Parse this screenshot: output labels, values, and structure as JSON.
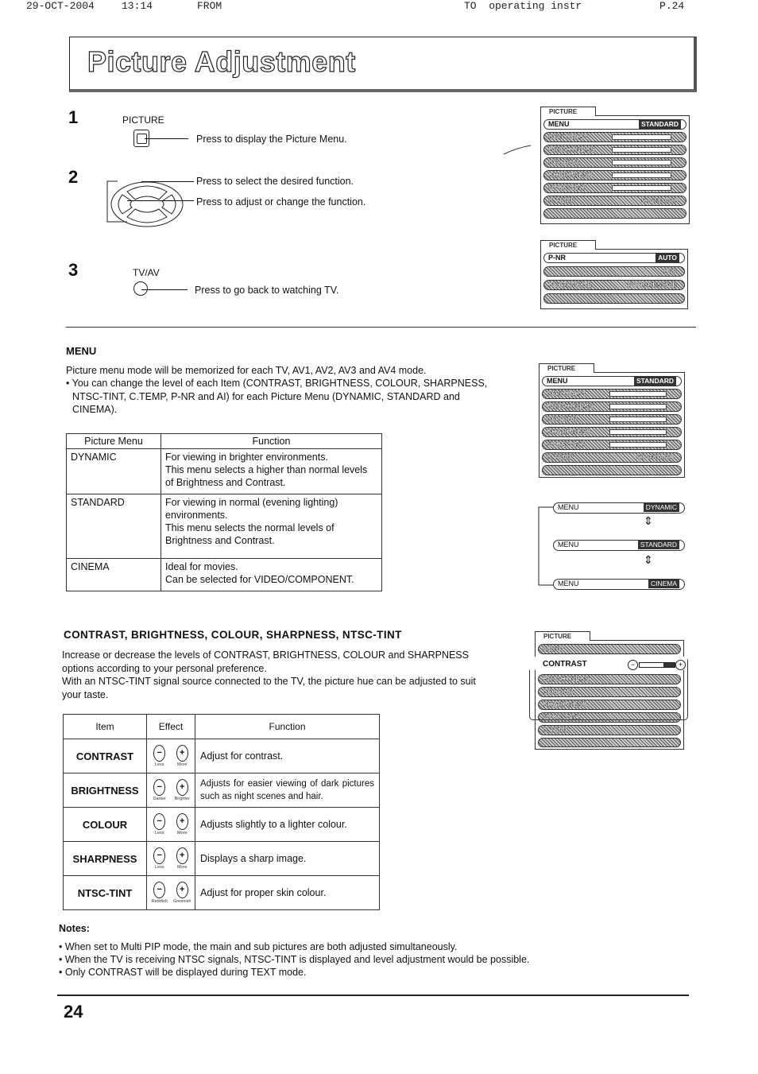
{
  "fax_header": {
    "date": "29-OCT-2004",
    "time": "13:14",
    "from": "FROM",
    "to": "TO  operating instr",
    "page": "P.24"
  },
  "title": "Picture Adjustment",
  "steps": [
    {
      "number": "1",
      "button_label": "PICTURE",
      "button_icon": "square-button-icon",
      "instructions": [
        "Press to display the Picture Menu."
      ]
    },
    {
      "number": "2",
      "button_label": "",
      "button_icon": "directional-pad-icon",
      "instructions": [
        "Press to select the desired function.",
        "Press to adjust or change the function."
      ]
    },
    {
      "number": "3",
      "button_label": "TV/AV",
      "button_icon": "round-button-icon",
      "instructions": [
        "Press to go back to watching TV."
      ]
    }
  ],
  "osd_menus": {
    "main_menu": {
      "tab": "PICTURE",
      "rows": [
        {
          "label": "MENU",
          "value": "STANDARD"
        },
        {
          "label": "CONTRAST",
          "value": ""
        },
        {
          "label": "BRIGHTNESS",
          "value": ""
        },
        {
          "label": "COLOUR",
          "value": ""
        },
        {
          "label": "SHARPNESS",
          "value": ""
        },
        {
          "label": "NTSC-TINT",
          "value": ""
        },
        {
          "label": "C.TEMP",
          "value": "STANDARD"
        },
        {
          "label": "",
          "value": ""
        }
      ]
    },
    "sub_menu": {
      "tab": "PICTURE",
      "rows": [
        {
          "label": "P-NR",
          "value": "AUTO"
        },
        {
          "label": "",
          "value": "OFF"
        },
        {
          "label": "SCAN MODE",
          "value": "PROGRESSIVE"
        },
        {
          "label": "",
          "value": ""
        }
      ]
    },
    "menu_menu": {
      "tab": "PICTURE",
      "rows": [
        {
          "label": "MENU",
          "value": "STANDARD"
        },
        {
          "label": "CONTRAST",
          "value": ""
        },
        {
          "label": "BRIGHTNESS",
          "value": ""
        },
        {
          "label": "COLOUR",
          "value": ""
        },
        {
          "label": "SHARPNESS",
          "value": ""
        },
        {
          "label": "NTSC-TINT",
          "value": ""
        },
        {
          "label": "C.TEMP",
          "value": "STANDARD"
        },
        {
          "label": "",
          "value": ""
        }
      ]
    },
    "menu_cycle": [
      {
        "label": "MENU",
        "value": "DYNAMIC"
      },
      {
        "label": "MENU",
        "value": "STANDARD"
      },
      {
        "label": "MENU",
        "value": "CINEMA"
      }
    ],
    "contrast_menu": {
      "tab": "PICTURE",
      "highlight": {
        "label": "CONTRAST",
        "minus": "−",
        "plus": "+"
      },
      "rows": [
        "MENU",
        "BRIGHTNESS",
        "COLOUR",
        "SHARPNESS",
        "NTSC-TINT",
        "C.TEMP",
        ""
      ]
    }
  },
  "menu_section": {
    "heading": "MENU",
    "paragraph": "Picture menu mode will be memorized for each TV, AV1, AV2, AV3 and AV4 mode.",
    "bullet": "You can change the level of each Item (CONTRAST, BRIGHTNESS,  COLOUR, SHARPNESS, NTSC-TINT, C.TEMP, P-NR and AI) for each Picture Menu (DYNAMIC, STANDARD and CINEMA).",
    "table": {
      "headers": [
        "Picture Menu",
        "Function"
      ],
      "rows": [
        {
          "menu": "DYNAMIC",
          "function": [
            "For viewing in brighter environments.",
            "This menu selects a higher than normal levels of Brightness and Contrast."
          ]
        },
        {
          "menu": "STANDARD",
          "function": [
            "For viewing in normal (evening lighting) environments.",
            "This menu selects the normal levels of Brightness and Contrast."
          ]
        },
        {
          "menu": "CINEMA",
          "function": [
            "Ideal for movies.",
            "Can be selected for VIDEO/COMPONENT."
          ]
        }
      ]
    }
  },
  "adjust_section": {
    "heading": "CONTRAST, BRIGHTNESS, COLOUR, SHARPNESS, NTSC-TINT",
    "paragraph1": "Increase or decrease the levels of CONTRAST, BRIGHTNESS, COLOUR and SHARPNESS options according to your personal preference.",
    "paragraph2": "With an NTSC-TINT signal source connected to the TV, the picture hue can be adjusted to suit your taste.",
    "table": {
      "headers": [
        "Item",
        "Effect",
        "Function"
      ],
      "rows": [
        {
          "item": "CONTRAST",
          "minus_label": "Less",
          "plus_label": "More",
          "function": "Adjust for contrast."
        },
        {
          "item": "BRIGHTNESS",
          "minus_label": "Darker",
          "plus_label": "Brighter",
          "function": "Adjusts for easier viewing of dark pictures such as night scenes and hair."
        },
        {
          "item": "COLOUR",
          "minus_label": "Less",
          "plus_label": "More",
          "function": "Adjusts slightly to a lighter colour."
        },
        {
          "item": "SHARPNESS",
          "minus_label": "Less",
          "plus_label": "More",
          "function": "Displays a sharp image."
        },
        {
          "item": "NTSC-TINT",
          "minus_label": "Reddish",
          "plus_label": "Greenish",
          "function": "Adjust for proper skin colour."
        }
      ]
    }
  },
  "notes": {
    "heading": "Notes:",
    "items": [
      "When set to Multi PIP mode, the main and sub pictures are both adjusted simultaneously.",
      "When the TV is receiving NTSC signals, NTSC-TINT is displayed and level adjustment would be possible.",
      "Only CONTRAST will be displayed during TEXT mode."
    ]
  },
  "page_number": "24"
}
